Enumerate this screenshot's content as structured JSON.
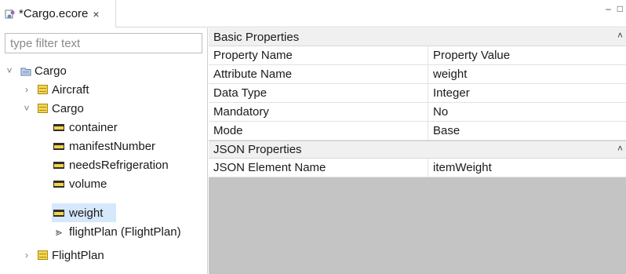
{
  "tab": {
    "title": "*Cargo.ecore",
    "close": "×",
    "icon": "ecore-file-icon"
  },
  "window": {
    "minimize": "–",
    "maximize": "□"
  },
  "filter": {
    "placeholder": "type filter text",
    "value": ""
  },
  "tree": {
    "root": {
      "label": "Cargo",
      "expanded": true,
      "icon": "package-icon"
    },
    "items": [
      {
        "label": "Aircraft",
        "kind": "class",
        "expanded": false,
        "twisty": ">"
      },
      {
        "label": "Cargo",
        "kind": "class",
        "expanded": true,
        "twisty": "v"
      },
      {
        "label": "container",
        "kind": "attribute"
      },
      {
        "label": "manifestNumber",
        "kind": "attribute"
      },
      {
        "label": "needsRefrigeration",
        "kind": "attribute"
      },
      {
        "label": "volume",
        "kind": "attribute"
      },
      {
        "label": "weight",
        "kind": "attribute",
        "selected": true
      },
      {
        "label": "flightPlan (FlightPlan)",
        "kind": "reference"
      },
      {
        "label": "FlightPlan",
        "kind": "class",
        "expanded": false,
        "twisty": ">"
      }
    ]
  },
  "properties": {
    "basic": {
      "title": "Basic Properties",
      "collapse": "˄",
      "header": {
        "name": "Property Name",
        "value": "Property Value"
      },
      "rows": [
        {
          "name": "Attribute Name",
          "value": "weight"
        },
        {
          "name": "Data Type",
          "value": "Integer"
        },
        {
          "name": "Mandatory",
          "value": "No"
        },
        {
          "name": "Mode",
          "value": "Base"
        }
      ]
    },
    "json": {
      "title": "JSON Properties",
      "collapse": "˄",
      "rows": [
        {
          "name": "JSON Element Name",
          "value": "itemWeight"
        }
      ]
    }
  },
  "colors": {
    "selection": "#d6e8fb",
    "empty_area": "#c4c4c4",
    "section_header": "#f0f0f0"
  }
}
